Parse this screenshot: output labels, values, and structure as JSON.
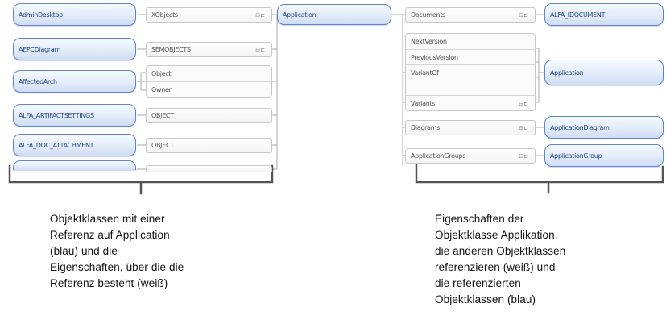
{
  "left_classes": [
    "AdminDesktop",
    "AEPCDiagram",
    "AffectedArch",
    "ALFA_ARTIFACTSETTINGS",
    "ALFA_DOC_ATTACHMENT"
  ],
  "left_properties": [
    "XObjects",
    "SEMOBJECTS",
    "Object",
    "Owner",
    "OBJECT",
    "OBJECT"
  ],
  "center_class": "Application",
  "right_properties": [
    "Documents",
    "NextVersion",
    "PreviousVersion",
    "VariantOf",
    "Variants",
    "Diagrams",
    "ApplicationGroups"
  ],
  "right_classes": [
    "ALFA_IDOCUMENT",
    "Application",
    "ApplicationDiagram",
    "ApplicationGroup"
  ],
  "expand_marker": "⊟⊏",
  "caption_left": "Objektklassen  mit einer\nReferenz auf Application\n(blau) und die\nEigenschaften, über die die\nReferenz besteht (weiß)",
  "caption_right": "Eigenschaften der\nObjektklasse  Applikation,\ndie anderen Objektklassen\nreferenzieren (weiß) und\ndie referenzierten\nObjektklassen  (blau)",
  "colors": {
    "class_border": "#5f86c6",
    "class_text": "#24487e",
    "property_border": "#c8c8c8",
    "brace": "#555555"
  }
}
